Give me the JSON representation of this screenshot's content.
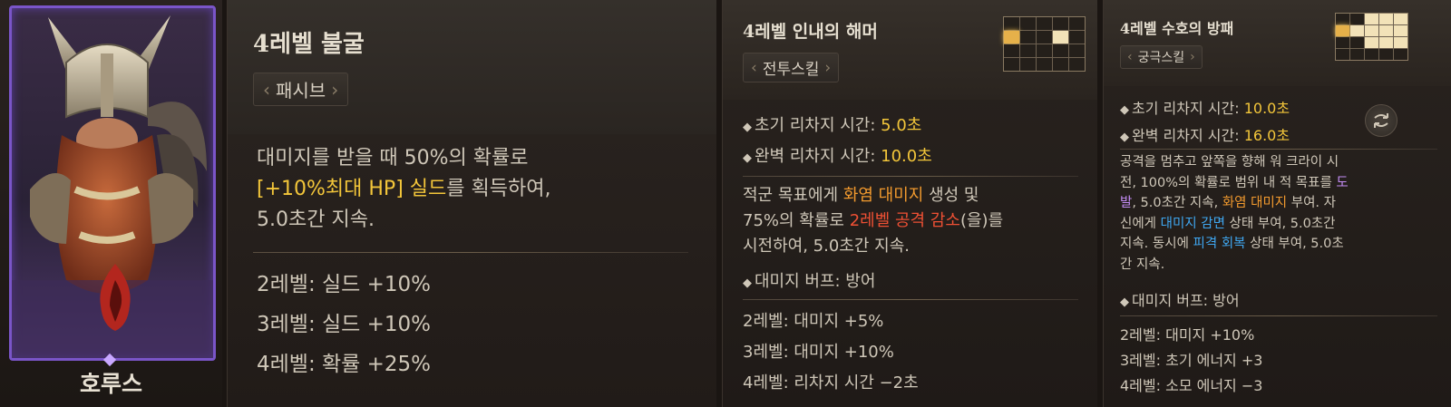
{
  "character": {
    "name": "호루스",
    "accent_color": "#7a55c8"
  },
  "passive": {
    "title": "4레벨 불굴",
    "tag": "패시브",
    "desc": {
      "line1": "대미지를 받을 때 50%의 확률로",
      "line2_highlight": "[+10%최대 HP] 실드",
      "line2_rest": "를 획득하여,",
      "line3": "5.0초간 지속."
    },
    "levels": [
      "2레벨: 실드 +10%",
      "3레벨: 실드 +10%",
      "4레벨: 확률 +25%"
    ]
  },
  "battle_skill": {
    "title": "4레벨 인내의 해머",
    "tag": "전투스킬",
    "stats": [
      {
        "label": "초기 리차지 시간: ",
        "value": "5.0초"
      },
      {
        "label": "완벽 리차지 시간: ",
        "value": "10.0초"
      }
    ],
    "desc": {
      "p1": "적군 목표에게 ",
      "h1": "화염 대미지",
      "p2": " 생성 및",
      "p3": "75%의 확률로 ",
      "h2": "2레벨 공격 감소",
      "p4": "(을)를",
      "p5": "시전하여, 5.0초간 지속."
    },
    "buff": "대미지 버프: 방어",
    "levels": [
      "2레벨: 대미지 +5%",
      "3레벨: 대미지 +10%",
      "4레벨: 리차지 시간 −2초"
    ]
  },
  "ultimate_skill": {
    "title": "4레벨 수호의 방패",
    "tag": "궁극스킬",
    "stats": [
      {
        "label": "초기 리차지 시간: ",
        "value": "10.0초"
      },
      {
        "label": "완벽 리차지 시간: ",
        "value": "16.0초"
      }
    ],
    "desc": {
      "p1": "공격을 멈추고 앞쪽을 향해 워 크라이 시",
      "p2": "전, 100%의 확률로 범위 내 적 목표를 ",
      "h1a": "도",
      "h1b": "발",
      "p3": ", 5.0초간 지속, ",
      "h2": "화염 대미지",
      "p4": " 부여. 자",
      "p5": "신에게 ",
      "h3": "대미지 감면",
      "p6": " 상태 부여, 5.0초간",
      "p7": "지속. 동시에 ",
      "h4": "피격 회복",
      "p8": " 상태 부여, 5.0초",
      "p9": "간 지속."
    },
    "buff": "대미지 버프: 방어",
    "levels": [
      "2레벨: 대미지 +10%",
      "3레벨: 초기 에너지 +3",
      "4레벨: 소모 에너지 −3"
    ]
  },
  "icons": [
    "swap-icon",
    "fire-emblem-icon",
    "range-grid-icon"
  ],
  "colors": {
    "highlight_yellow": "#f3c63a",
    "highlight_orange": "#f29a2e",
    "highlight_red": "#ef5034",
    "highlight_purple": "#c38cf4",
    "highlight_blue": "#3fa7f0",
    "frame_purple": "#7a55c8"
  }
}
